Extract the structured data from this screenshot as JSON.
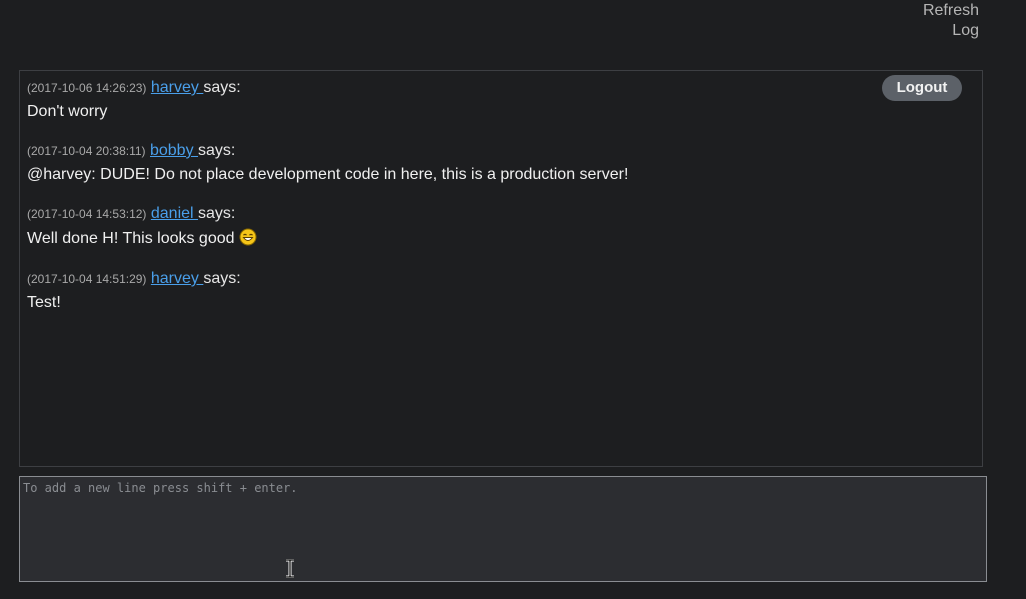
{
  "header": {
    "refresh_label": "Refresh Log"
  },
  "chat": {
    "logout_label": "Logout",
    "says_label": "says:",
    "messages": [
      {
        "timestamp": "(2017-10-06 14:26:23)",
        "user": "harvey ",
        "text": "Don't worry"
      },
      {
        "timestamp": "(2017-10-04 20:38:11)",
        "user": "bobby ",
        "text": "@harvey: DUDE! Do not place development code in here, this is a production server!"
      },
      {
        "timestamp": "(2017-10-04 14:53:12)",
        "user": "daniel ",
        "text": "Well done H! This looks good",
        "emoji": "laughing-smiley-icon"
      },
      {
        "timestamp": "(2017-10-04 14:51:29)",
        "user": "harvey ",
        "text": "Test!"
      }
    ]
  },
  "input": {
    "placeholder": "To add a new line press shift + enter.",
    "value": ""
  },
  "colors": {
    "background": "#1d1e20",
    "link": "#4a9fea",
    "logout_bg": "#5c6168",
    "input_bg": "#2c2d31"
  }
}
